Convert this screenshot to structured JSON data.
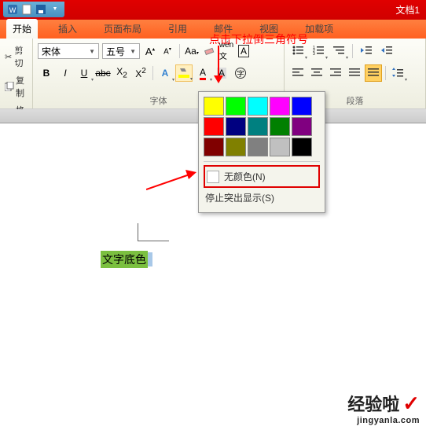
{
  "title": "文档1",
  "tabs": {
    "start": "开始",
    "insert": "插入",
    "layout": "页面布局",
    "ref": "引用",
    "mail": "邮件",
    "view": "视图",
    "addin": "加载项"
  },
  "clipboard": {
    "cut": "剪切",
    "copy": "复制",
    "painter": "格式刷"
  },
  "font": {
    "name": "宋体",
    "size": "五号",
    "group_label": "字体"
  },
  "paragraph": {
    "group_label": "段落"
  },
  "annotation": {
    "text1": "点击下拉倒三角符号"
  },
  "dropdown": {
    "no_color": "无颜色(N)",
    "stop_highlight": "停止突出显示(S)",
    "colors": [
      [
        "#ffff00",
        "#00ff00",
        "#00ffff",
        "#ff00ff",
        "#0000ff"
      ],
      [
        "#ff0000",
        "#000080",
        "#008080",
        "#008000",
        "#800080"
      ],
      [
        "#800000",
        "#808000",
        "#808080",
        "#c0c0c0",
        "#000000"
      ]
    ]
  },
  "doc_text": "文字底色",
  "watermark": {
    "main": "经验啦",
    "sub": "jingyanla.com"
  }
}
